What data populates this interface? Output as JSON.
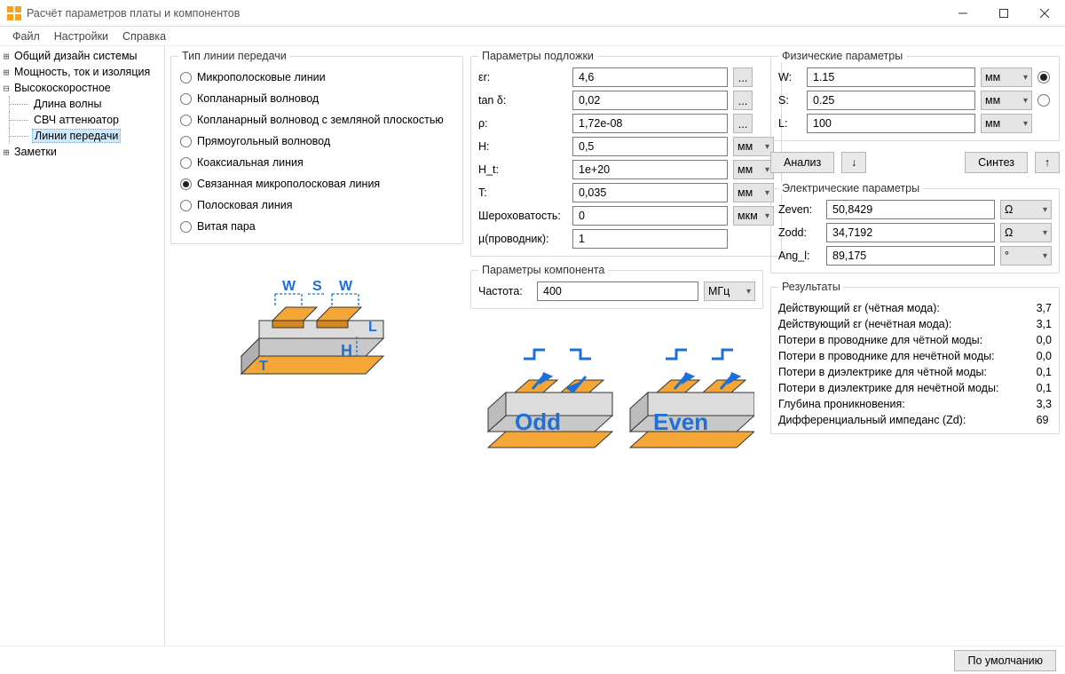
{
  "window": {
    "title": "Расчёт параметров платы и компонентов"
  },
  "menu": {
    "file": "Файл",
    "settings": "Настройки",
    "help": "Справка"
  },
  "tree": {
    "n1": "Общий дизайн системы",
    "n2": "Мощность, ток и изоляция",
    "n3": "Высокоскоростное",
    "n3a": "Длина волны",
    "n3b": "СВЧ аттенюатор",
    "n3c": "Линии передачи",
    "n4": "Заметки"
  },
  "groups": {
    "line_type": "Тип линии передачи",
    "substrate": "Параметры подложки",
    "physical": "Физические параметры",
    "component": "Параметры компонента",
    "electrical": "Электрические параметры",
    "results": "Результаты"
  },
  "line_types": {
    "microstrip": "Микрополосковые линии",
    "cpw": "Копланарный волновод",
    "cpw_gnd": "Копланарный волновод с земляной плоскостью",
    "rectwg": "Прямоугольный волновод",
    "coax": "Коаксиальная линия",
    "coupled_ms": "Связанная микрополосковая линия",
    "stripline": "Полосковая линия",
    "twisted": "Витая пара"
  },
  "substrate": {
    "er_lbl": "εr:",
    "er_val": "4,6",
    "tand_lbl": "tan δ:",
    "tand_val": "0,02",
    "rho_lbl": "ρ:",
    "rho_val": "1,72e-08",
    "h_lbl": "H:",
    "h_val": "0,5",
    "ht_lbl": "H_t:",
    "ht_val": "1e+20",
    "t_lbl": "T:",
    "t_val": "0,035",
    "rough_lbl": "Шероховатость:",
    "rough_val": "0",
    "mu_lbl": "µ(проводник):",
    "mu_val": "1"
  },
  "units": {
    "mm": "мм",
    "um": "мкм",
    "mhz": "МГц",
    "ohm": "Ω",
    "deg": "°"
  },
  "physical": {
    "w_lbl": "W:",
    "w_val": "1.15",
    "s_lbl": "S:",
    "s_val": "0.25",
    "l_lbl": "L:",
    "l_val": "100"
  },
  "actions": {
    "analyze": "Анализ",
    "synth": "Синтез",
    "default": "По умолчанию",
    "ellipsis": "..."
  },
  "component": {
    "freq_lbl": "Частота:",
    "freq_val": "400"
  },
  "electrical": {
    "zeven_lbl": "Zeven:",
    "zeven_val": "50,8429",
    "zodd_lbl": "Zodd:",
    "zodd_val": "34,7192",
    "angl_lbl": "Ang_l:",
    "angl_val": "89,175"
  },
  "results": {
    "r1_lbl": "Действующий εr (чётная мода):",
    "r1_val": "3,7",
    "r2_lbl": "Действующий εr (нечётная мода):",
    "r2_val": "3,1",
    "r3_lbl": "Потери в проводнике для чётной моды:",
    "r3_val": "0,0",
    "r4_lbl": "Потери в проводнике для нечётной моды:",
    "r4_val": "0,0",
    "r5_lbl": "Потери в диэлектрике для чётной моды:",
    "r5_val": "0,1",
    "r6_lbl": "Потери в диэлектрике для нечётной моды:",
    "r6_val": "0,1",
    "r7_lbl": "Глубина проникновения:",
    "r7_val": "3,3",
    "r8_lbl": "Дифференциальный импеданс (Zd):",
    "r8_val": "69"
  },
  "diagram_labels": {
    "w": "W",
    "s": "S",
    "t": "T",
    "h": "H",
    "l": "L",
    "odd": "Odd",
    "even": "Even"
  }
}
